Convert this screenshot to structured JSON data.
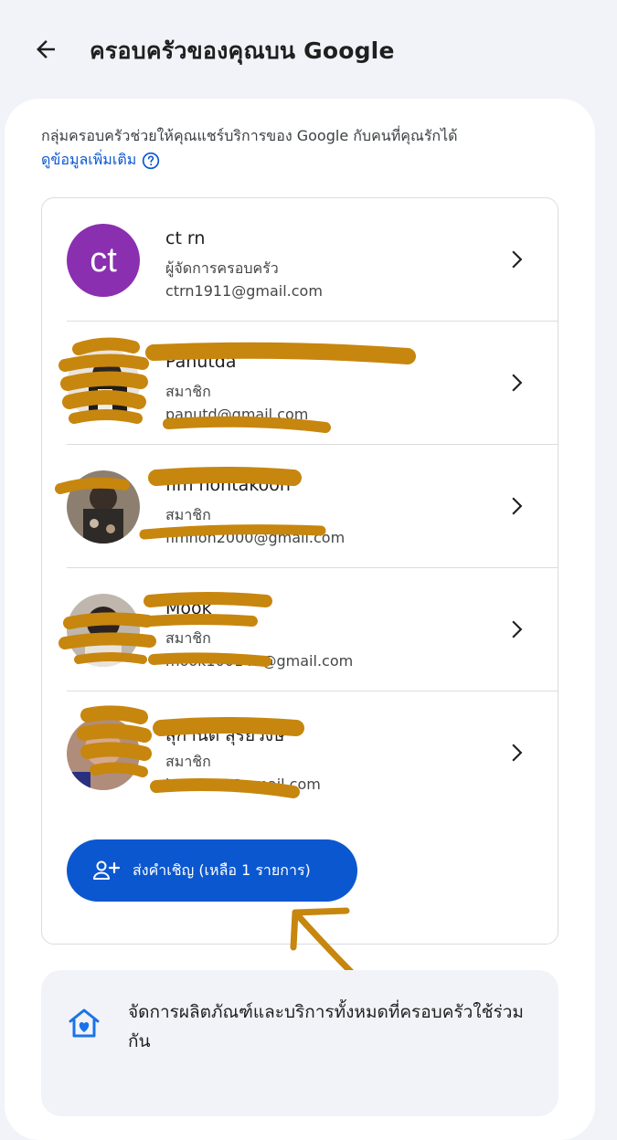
{
  "header": {
    "title": "ครอบครัวของคุณบน Google",
    "back_icon": "arrow-left-icon"
  },
  "intro": {
    "description": "กลุ่มครอบครัวช่วยให้คุณแชร์บริการของ Google กับคนที่คุณรักได้",
    "learn_more": "ดูข้อมูลเพิ่มเติม",
    "learn_more_icon": "help-circle-icon"
  },
  "members": [
    {
      "initials": "ct",
      "name": "ct rn",
      "role": "ผู้จัดการครอบครัว",
      "email": "ctrn1911@gmail.com",
      "avatar_color": "#8a2fb0"
    },
    {
      "name": "Panutda",
      "role": "สมาชิก",
      "email": "panutd@gmail.com"
    },
    {
      "name": "fim nontakoon",
      "role": "สมาชิก",
      "email": "fimnon2000@gmail.com"
    },
    {
      "name": "Mook",
      "role": "สมาชิก",
      "email": "mook100147@gmail.com"
    },
    {
      "name": "สุกานต์ สุริยวงษ์",
      "role": "สมาชิก",
      "email": "kantin44@gmail.com"
    }
  ],
  "invite": {
    "label": "ส่งคำเชิญ (เหลือ 1 รายการ)",
    "icon": "person-add-icon"
  },
  "manage": {
    "label": "จัดการผลิตภัณฑ์และบริการทั้งหมดที่ครอบครัวใช้ร่วมกัน",
    "icon": "family-home-heart-icon"
  },
  "colors": {
    "accent": "#0b57d0",
    "background": "#f1f3f8",
    "manager_avatar": "#8a2fb0",
    "redaction": "#c7860e"
  }
}
